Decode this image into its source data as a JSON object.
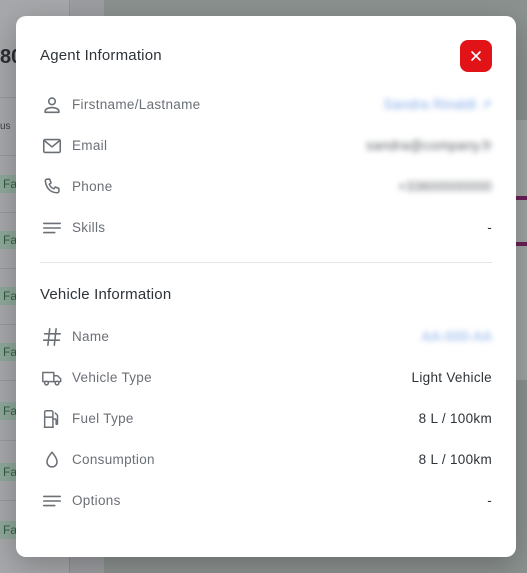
{
  "background": {
    "number_fragment": "80",
    "status_fragment": "us",
    "row_tag": "Fait"
  },
  "agent": {
    "title": "Agent Information",
    "close_icon": "close-icon",
    "rows": [
      {
        "icon": "person-icon",
        "label": "Firstname/Lastname",
        "value": "Sandra Rinaldi ↗"
      },
      {
        "icon": "mail-icon",
        "label": "Email",
        "value": "sandra@company.fr"
      },
      {
        "icon": "phone-icon",
        "label": "Phone",
        "value": "+33600000000"
      },
      {
        "icon": "list-icon",
        "label": "Skills",
        "value": "-"
      }
    ]
  },
  "vehicle": {
    "title": "Vehicle Information",
    "rows": [
      {
        "icon": "hash-icon",
        "label": "Name",
        "value": "AA-000-AA"
      },
      {
        "icon": "truck-icon",
        "label": "Vehicle Type",
        "value": "Light Vehicle"
      },
      {
        "icon": "fuel-icon",
        "label": "Fuel Type",
        "value": "8 L / 100km"
      },
      {
        "icon": "drop-icon",
        "label": "Consumption",
        "value": "8 L / 100km"
      },
      {
        "icon": "list-icon",
        "label": "Options",
        "value": "-"
      }
    ]
  },
  "colors": {
    "close_button": "#e21317",
    "icon_gray": "#6b7077",
    "text_dark": "#2e3338",
    "link_blue": "#7ea6e6"
  }
}
